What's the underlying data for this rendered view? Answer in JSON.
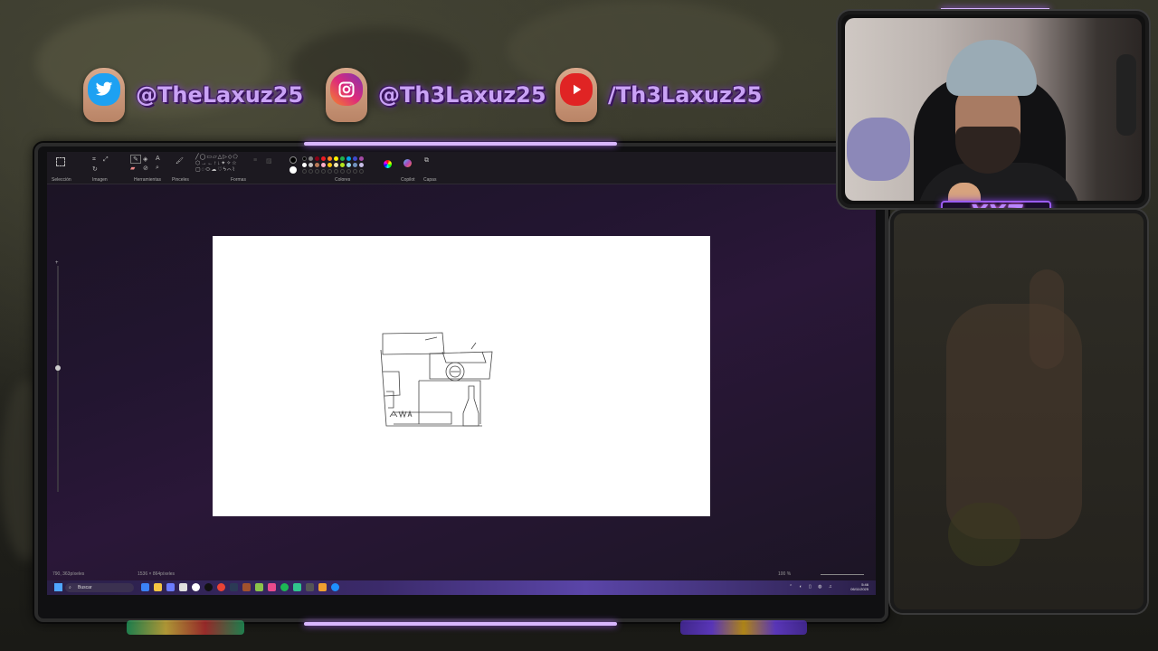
{
  "social": {
    "twitter_handle": "@TheLaxuz25",
    "instagram_handle": "@Th3Laxuz25",
    "youtube_handle": "/Th3Laxuz25"
  },
  "paint": {
    "ribbon_groups": [
      "Selección",
      "Imagen",
      "Herramientas",
      "Pinceles",
      "Formas",
      "Colores",
      "Copilot",
      "Capas"
    ],
    "status_left": "790, 363píxeles",
    "status_size": "1536 × 864píxeles",
    "zoom_level": "100 %"
  },
  "taskbar": {
    "search_placeholder": "Buscar",
    "time": "5:46",
    "date": "06/11/2025"
  },
  "overlay": {
    "badge_text": "XXZ"
  },
  "colors": {
    "accent": "#b986ff",
    "neon": "#d8b6ff",
    "twitter": "#1da1f2",
    "instagram": "#c13584",
    "youtube": "#e02424"
  }
}
